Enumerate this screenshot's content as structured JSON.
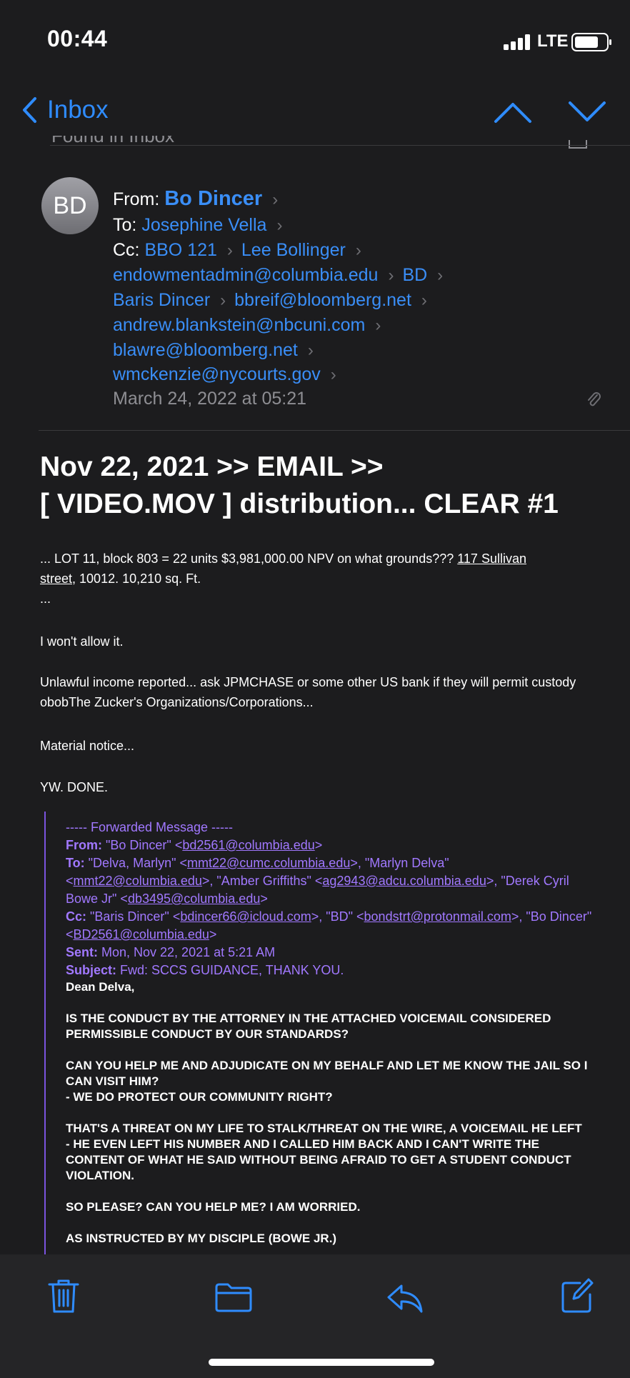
{
  "status": {
    "time": "00:44",
    "network": "LTE"
  },
  "nav": {
    "back_label": "Inbox"
  },
  "found_in": "Found in Inbox",
  "header": {
    "avatar_initials": "BD",
    "from_label": "From:",
    "from_name": "Bo Dincer",
    "to_label": "To:",
    "to_name": "Josephine Vella",
    "cc_label": "Cc:",
    "cc": [
      "BBO 121",
      "Lee Bollinger",
      "endowmentadmin@columbia.edu",
      "BD",
      "Baris Dincer",
      "bbreif@bloomberg.net",
      "andrew.blankstein@nbcuni.com",
      "blawre@bloomberg.net",
      "wmckenzie@nycourts.gov"
    ],
    "date": "March 24, 2022 at 05:21"
  },
  "subject": [
    "Nov 22, 2021 >> EMAIL >>",
    "[ VIDEO.MOV ] distribution... CLEAR #1"
  ],
  "body": {
    "p1_a": "... LOT 11, block 803 = 22 units $3,981,000.00 NPV on what grounds??? ",
    "p1_link": "117 Sullivan",
    "p1_b": "street",
    "p1_c": ", 10012. 10,210 sq. Ft.",
    "p1_d": "...",
    "p2": "I won't allow it.",
    "p3": "Unlawful income reported... ask JPMCHASE or some other US bank if they will permit custody obobThe Zucker's Organizations/Corporations...",
    "p4": "Material notice...",
    "p5": "YW. DONE."
  },
  "forwarded": {
    "heading": "----- Forwarded Message -----",
    "from_label": "From:",
    "from_name": " \"Bo Dincer\" <",
    "from_email": "bd2561@columbia.edu",
    "from_end": ">",
    "to_label": "To:",
    "to_1": " \"Delva, Marlyn\" <",
    "to_1_email": "mmt22@cumc.columbia.edu",
    "to_2": ">, \"Marlyn Delva\" <",
    "to_2_email": "mmt22@columbia.edu",
    "to_3": ">, \"Amber Griffiths\" <",
    "to_3_email": "ag2943@adcu.columbia.edu",
    "to_4": ">, \"Derek Cyril Bowe Jr\" <",
    "to_4_email": "db3495@columbia.edu",
    "to_end": ">",
    "cc_label": "Cc:",
    "cc_1": " \"Baris Dincer\" <",
    "cc_1_email": "bdincer66@icloud.com",
    "cc_2": ">, \"BD\" <",
    "cc_2_email": "bondstrt@protonmail.com",
    "cc_3": ">, \"Bo Dincer\" <",
    "cc_3_email": "BD2561@columbia.edu",
    "cc_end": ">",
    "sent_label": "Sent:",
    "sent": " Mon, Nov 22, 2021 at 5:21 AM",
    "subject_label": "Subject:",
    "subject": " Fwd: SCCS GUIDANCE, THANK YOU.",
    "greeting": "Dean Delva,",
    "b1": "IS THE CONDUCT BY THE ATTORNEY IN THE ATTACHED VOICEMAIL CONSIDERED PERMISSIBLE CONDUCT BY OUR STANDARDS?",
    "b2": "CAN YOU HELP ME AND ADJUDICATE ON MY BEHALF AND LET ME KNOW THE JAIL SO I CAN VISIT HIM?",
    "b3": "- WE DO PROTECT OUR COMMUNITY RIGHT?",
    "b4": "THAT'S A THREAT ON MY LIFE TO STALK/THREAT ON THE WIRE, A VOICEMAIL HE LEFT",
    "b5": " - HE EVEN LEFT HIS NUMBER AND I CALLED HIM BACK AND I CAN'T WRITE THE CONTENT OF WHAT HE SAID WITHOUT BEING AFRAID TO GET A STUDENT CONDUCT VIOLATION.",
    "b6": "SO PLEASE? CAN YOU HELP ME? I AM WORRIED.",
    "b7": "AS INSTRUCTED BY MY DISCIPLE (BOWE JR.)"
  },
  "toolbar": {
    "icons": [
      "trash-icon",
      "folder-icon",
      "reply-icon",
      "compose-icon"
    ]
  },
  "colors": {
    "accent": "#3a8ef7",
    "forward": "#a178ff",
    "background": "#1c1c1e"
  }
}
